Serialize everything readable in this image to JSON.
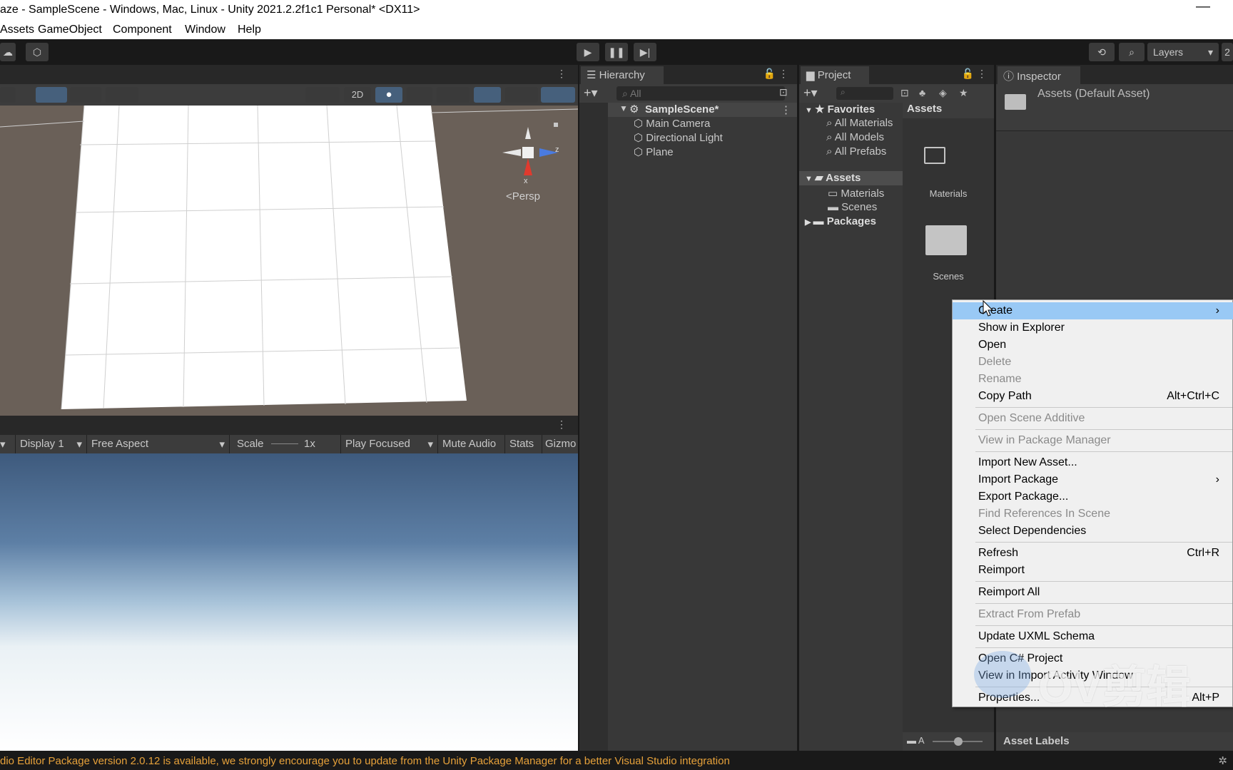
{
  "window": {
    "title": "aze - SampleScene - Windows, Mac, Linux - Unity 2021.2.2f1c1 Personal* <DX11>",
    "minimize_icon": "minimize-icon"
  },
  "menubar": {
    "items": [
      "Assets",
      "GameObject",
      "Component",
      "Window",
      "Help"
    ]
  },
  "toolbar": {
    "layers_label": "Layers",
    "layout_label": "2"
  },
  "scene_view": {
    "mode_2d": "2D",
    "gizmo_x": "x",
    "gizmo_z": "z",
    "persp_label": "<Persp"
  },
  "game_view": {
    "display": "Display 1",
    "aspect": "Free Aspect",
    "scale_label": "Scale",
    "scale_value": "1x",
    "play_mode": "Play Focused",
    "mute": "Mute Audio",
    "stats": "Stats",
    "gizmos": "Gizmo"
  },
  "hierarchy": {
    "tab": "Hierarchy",
    "search_placeholder": "All",
    "scene": "SampleScene*",
    "items": [
      "Main Camera",
      "Directional Light",
      "Plane"
    ]
  },
  "project": {
    "tab": "Project",
    "favorites_label": "Favorites",
    "favorites": [
      "All Materials",
      "All Models",
      "All Prefabs"
    ],
    "assets_label": "Assets",
    "asset_folders": [
      "Materials",
      "Scenes"
    ],
    "packages_label": "Packages",
    "assets_header": "Assets",
    "grid_items": [
      "Materials",
      "Scenes"
    ],
    "footer_label": "A"
  },
  "inspector": {
    "tab": "Inspector",
    "title": "Assets (Default Asset)",
    "asset_labels": "Asset Labels"
  },
  "context_menu": {
    "items": [
      {
        "label": "Create",
        "shortcut": "",
        "arrow": "›",
        "enabled": true
      },
      {
        "label": "Show in Explorer",
        "shortcut": "",
        "enabled": true
      },
      {
        "label": "Open",
        "shortcut": "",
        "enabled": true
      },
      {
        "label": "Delete",
        "shortcut": "",
        "enabled": false
      },
      {
        "label": "Rename",
        "shortcut": "",
        "enabled": false
      },
      {
        "label": "Copy Path",
        "shortcut": "Alt+Ctrl+C",
        "enabled": true
      },
      {
        "label": "Open Scene Additive",
        "shortcut": "",
        "enabled": false
      },
      {
        "label": "View in Package Manager",
        "shortcut": "",
        "enabled": false
      },
      {
        "label": "Import New Asset...",
        "shortcut": "",
        "enabled": true
      },
      {
        "label": "Import Package",
        "shortcut": "",
        "arrow": "›",
        "enabled": true
      },
      {
        "label": "Export Package...",
        "shortcut": "",
        "enabled": true
      },
      {
        "label": "Find References In Scene",
        "shortcut": "",
        "enabled": false
      },
      {
        "label": "Select Dependencies",
        "shortcut": "",
        "enabled": true
      },
      {
        "label": "Refresh",
        "shortcut": "Ctrl+R",
        "enabled": true
      },
      {
        "label": "Reimport",
        "shortcut": "",
        "enabled": true
      },
      {
        "label": "Reimport All",
        "shortcut": "",
        "enabled": true
      },
      {
        "label": "Extract From Prefab",
        "shortcut": "",
        "enabled": false
      },
      {
        "label": "Update UXML Schema",
        "shortcut": "",
        "enabled": true
      },
      {
        "label": "Open C# Project",
        "shortcut": "",
        "enabled": true
      },
      {
        "label": "View in Import Activity Window",
        "shortcut": "",
        "enabled": true
      },
      {
        "label": "Properties...",
        "shortcut": "Alt+P",
        "enabled": true
      }
    ]
  },
  "watermark": "OV剪辑",
  "status": {
    "message": "dio Editor Package version 2.0.12 is available, we strongly encourage you to update from the Unity Package Manager for a better Visual Studio integration"
  }
}
